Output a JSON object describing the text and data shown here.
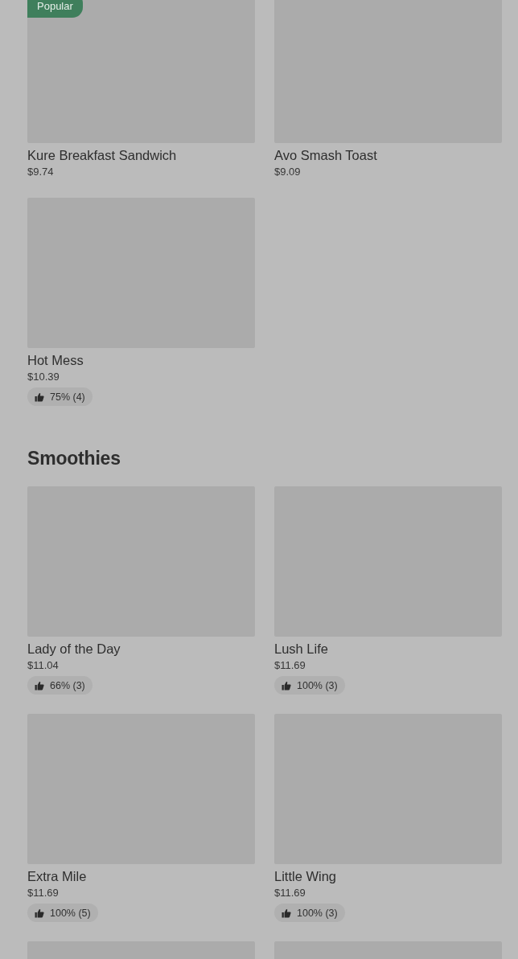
{
  "sections": [
    {
      "items": [
        {
          "kind": "dish",
          "name": "Kure Breakfast Sandwich",
          "price": "$9.74",
          "badge": "Popular"
        },
        {
          "kind": "dish",
          "name": "Avo Smash Toast",
          "price": "$9.09"
        },
        {
          "kind": "dish",
          "name": "Hot Mess",
          "price": "$10.39",
          "rating": "75% (4)"
        }
      ]
    },
    {
      "title": "Smoothies",
      "items": [
        {
          "kind": "dish",
          "name": "Lady of the Day",
          "price": "$11.04",
          "rating": "66% (3)"
        },
        {
          "kind": "dish",
          "name": "Lush Life",
          "price": "$11.69",
          "rating": "100% (3)"
        },
        {
          "kind": "dish",
          "name": "Extra Mile",
          "price": "$11.69",
          "rating": "100% (5)"
        },
        {
          "kind": "dish",
          "name": "Little Wing",
          "price": "$11.69",
          "rating": "100% (3)"
        },
        {
          "kind": "image_only"
        },
        {
          "kind": "image_only"
        }
      ]
    }
  ]
}
